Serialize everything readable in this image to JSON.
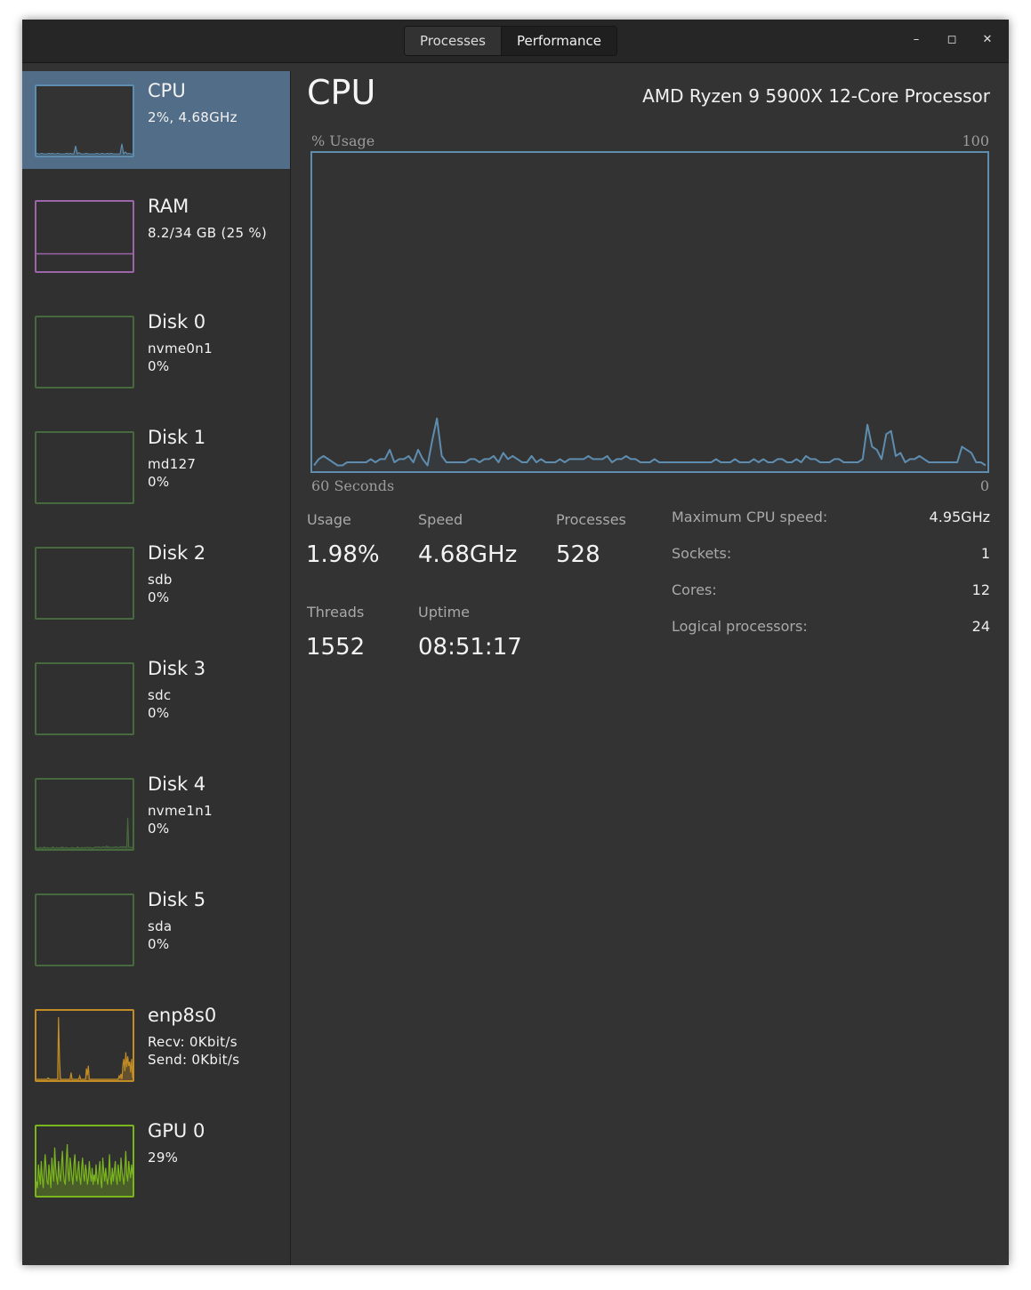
{
  "tabs": [
    {
      "label": "Processes"
    },
    {
      "label": "Performance"
    }
  ],
  "window_controls": {
    "minimize": "–",
    "maximize": "◻",
    "close": "✕"
  },
  "sidebar": {
    "items": [
      {
        "name": "CPU",
        "lines": [
          "2%, 4.68GHz"
        ],
        "color": "#5f8daf",
        "graph": [
          2,
          1,
          1,
          2,
          1,
          1,
          1,
          2,
          1,
          2,
          1,
          1,
          2,
          1,
          1,
          1,
          1,
          2,
          1,
          2,
          1,
          1,
          13,
          1,
          3,
          1,
          1,
          1,
          2,
          1,
          1,
          1,
          1,
          1,
          2,
          1,
          1,
          2,
          1,
          1,
          2,
          1,
          2,
          1,
          1,
          1,
          1,
          1,
          16,
          1,
          4,
          1,
          2,
          1,
          1
        ]
      },
      {
        "name": "RAM",
        "lines": [
          "8.2/34 GB (25 %)"
        ],
        "color": "#9b65a8",
        "graph_level": 25
      },
      {
        "name": "Disk 0",
        "lines": [
          "nvme0n1",
          "0%"
        ],
        "color": "#46693d"
      },
      {
        "name": "Disk 1",
        "lines": [
          "md127",
          "0%"
        ],
        "color": "#46693d"
      },
      {
        "name": "Disk 2",
        "lines": [
          "sdb",
          "0%"
        ],
        "color": "#46693d"
      },
      {
        "name": "Disk 3",
        "lines": [
          "sdc",
          "0%"
        ],
        "color": "#46693d"
      },
      {
        "name": "Disk 4",
        "lines": [
          "nvme1n1",
          "0%"
        ],
        "color": "#46693d",
        "graph": [
          0,
          0,
          0,
          0,
          1,
          0,
          0,
          0,
          2,
          0,
          0,
          1,
          0,
          0,
          0,
          0,
          0,
          2,
          0,
          0,
          0,
          1,
          0,
          0,
          0,
          1,
          0,
          2,
          0,
          0,
          0,
          1,
          0,
          0,
          0,
          0,
          0,
          1,
          0,
          0,
          0,
          0,
          0,
          2,
          0,
          0,
          0,
          1,
          0,
          0,
          1,
          0,
          1,
          1,
          1,
          0,
          1,
          0,
          0,
          0,
          1,
          1,
          2,
          1,
          1,
          2,
          1,
          1,
          1,
          2,
          2,
          1,
          1,
          3,
          1,
          2,
          1,
          1,
          1,
          1,
          1,
          1,
          2,
          2,
          1,
          1,
          1,
          2,
          2,
          1,
          2,
          2,
          2,
          1,
          1,
          45,
          2,
          1,
          1,
          1,
          1
        ]
      },
      {
        "name": "Disk 5",
        "lines": [
          "sda",
          "0%"
        ],
        "color": "#46693d"
      },
      {
        "name": "enp8s0",
        "lines": [
          "Recv: 0Kbit/s",
          "Send: 0Kbit/s"
        ],
        "color": "#c38c24",
        "graph": [
          0,
          0,
          0,
          0,
          0,
          0,
          0,
          0,
          0,
          0,
          0,
          0,
          2,
          1,
          0,
          0,
          0,
          0,
          0,
          0,
          0,
          0,
          0,
          92,
          30,
          0,
          0,
          0,
          0,
          0,
          0,
          0,
          0,
          0,
          0,
          0,
          10,
          0,
          0,
          0,
          0,
          0,
          0,
          0,
          0,
          5,
          0,
          0,
          0,
          0,
          0,
          0,
          16,
          6,
          20,
          0,
          0,
          0,
          0,
          0,
          0,
          0,
          0,
          0,
          0,
          0,
          0,
          0,
          0,
          0,
          0,
          0,
          0,
          0,
          0,
          0,
          0,
          0,
          0,
          0,
          0,
          0,
          0,
          0,
          0,
          0,
          5,
          2,
          8,
          0,
          22,
          30,
          12,
          40,
          18,
          34,
          20,
          26,
          10,
          30,
          2
        ]
      },
      {
        "name": "GPU 0",
        "lines": [
          "29%"
        ],
        "color": "#7ab51d",
        "graph": [
          20,
          10,
          45,
          30,
          15,
          50,
          25,
          10,
          35,
          60,
          40,
          20,
          15,
          45,
          30,
          10,
          55,
          35,
          20,
          70,
          40,
          25,
          15,
          50,
          30,
          20,
          45,
          65,
          35,
          20,
          15,
          50,
          75,
          35,
          20,
          55,
          40,
          25,
          15,
          45,
          60,
          30,
          20,
          35,
          50,
          25,
          15,
          40,
          55,
          30,
          20,
          45,
          35,
          15,
          25,
          50,
          30,
          20,
          40,
          15,
          30,
          20,
          45,
          25,
          15,
          35,
          50,
          20,
          10,
          55,
          35,
          20,
          40,
          25,
          15,
          30,
          60,
          25,
          15,
          40,
          20,
          35,
          50,
          25,
          15,
          45,
          30,
          20,
          55,
          35,
          25,
          15,
          40,
          65,
          30,
          20,
          50,
          35,
          25,
          45,
          30
        ]
      }
    ]
  },
  "main": {
    "title": "CPU",
    "model": "AMD Ryzen 9 5900X 12-Core Processor",
    "graph_ylabel": "% Usage",
    "graph_ymax": "100",
    "graph_xlabel": "60 Seconds",
    "graph_xmin": "0",
    "stats": {
      "usage_label": "Usage",
      "usage_value": "1.98%",
      "speed_label": "Speed",
      "speed_value": "4.68GHz",
      "processes_label": "Processes",
      "processes_value": "528",
      "threads_label": "Threads",
      "threads_value": "1552",
      "uptime_label": "Uptime",
      "uptime_value": "08:51:17"
    },
    "specs": [
      {
        "label": "Maximum CPU speed:",
        "value": "4.95GHz"
      },
      {
        "label": "Sockets:",
        "value": "1"
      },
      {
        "label": "Cores:",
        "value": "12"
      },
      {
        "label": "Logical processors:",
        "value": "24"
      }
    ]
  },
  "chart_data": {
    "type": "line",
    "ylim": [
      0,
      100
    ],
    "series": [
      {
        "values": [
          1,
          3,
          4,
          3,
          2,
          1,
          1,
          2,
          2,
          2,
          2,
          2,
          3,
          2,
          3,
          3,
          6,
          2,
          3,
          3,
          4,
          2,
          6,
          3,
          1,
          9,
          16,
          4,
          2,
          2,
          2,
          2,
          2,
          3,
          3,
          2,
          3,
          3,
          4,
          2,
          5,
          3,
          4,
          3,
          2,
          2,
          4,
          2,
          3,
          2,
          2,
          2,
          3,
          2,
          3,
          3,
          3,
          3,
          4,
          3,
          3,
          3,
          4,
          2,
          3,
          3,
          4,
          3,
          3,
          2,
          2,
          2,
          3,
          2,
          2,
          2,
          2,
          2,
          2,
          2,
          2,
          2,
          2,
          2,
          2,
          3,
          2,
          2,
          2,
          3,
          2,
          2,
          2,
          3,
          2,
          3,
          2,
          2,
          3,
          3,
          2,
          2,
          3,
          2,
          4,
          3,
          3,
          2,
          2,
          2,
          3,
          3,
          2,
          2,
          2,
          2,
          3,
          14,
          7,
          6,
          3,
          11,
          12,
          4,
          5,
          2,
          3,
          3,
          4,
          3,
          2,
          2,
          2,
          2,
          2,
          2,
          2,
          7,
          6,
          5,
          2,
          2,
          1
        ]
      }
    ]
  }
}
